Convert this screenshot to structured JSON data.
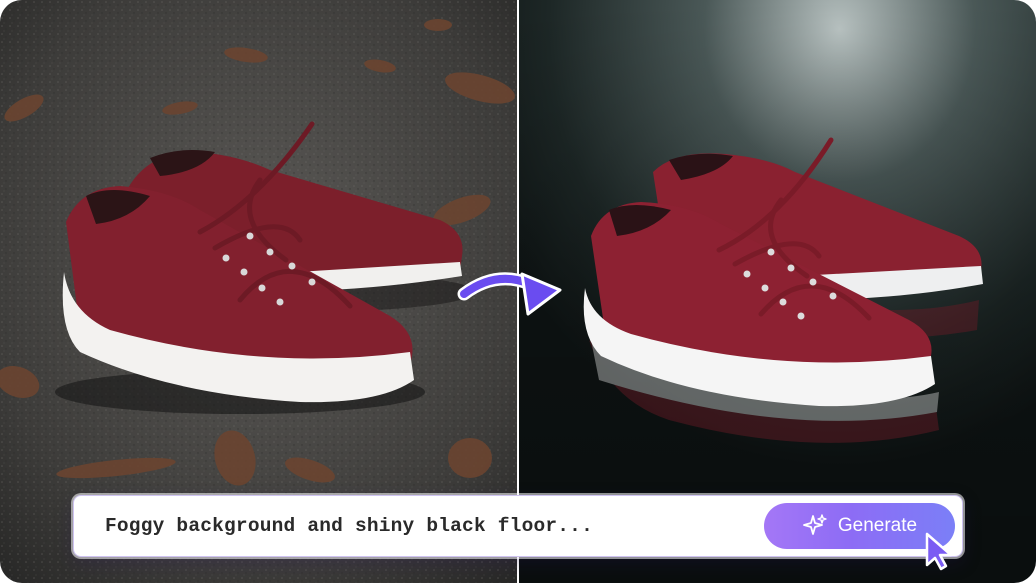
{
  "prompt": {
    "text": "Foggy background and shiny black floor...",
    "button_label": "Generate",
    "button_icon": "sparkle-icon"
  },
  "images": {
    "before": "red-sneakers-on-asphalt-with-leaves",
    "after": "red-sneakers-on-shiny-black-floor-with-fog"
  },
  "colors": {
    "accent_gradient_start": "#a477f6",
    "accent_gradient_end": "#7b7ff7",
    "arrow": "#6a4cf0",
    "shoe": "#7c1f2b"
  }
}
